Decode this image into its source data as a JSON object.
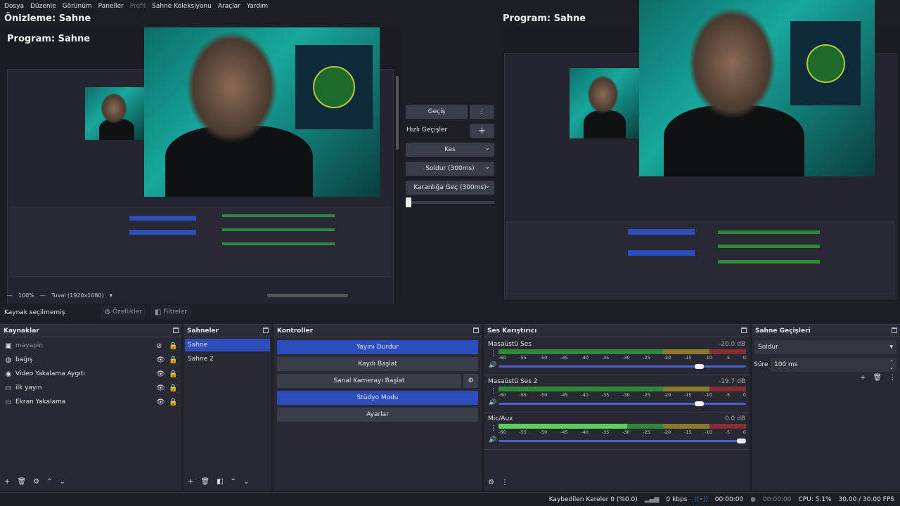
{
  "menu": [
    "Dosya",
    "Düzenle",
    "Görünüm",
    "Paneller",
    "Profil",
    "Sahne Koleksiyonu",
    "Araçlar",
    "Yardım"
  ],
  "menu_disabled": "Profil",
  "preview": {
    "title": "Önizleme: Sahne",
    "inner_program_title": "Program: Sahne",
    "zoom": "100%",
    "canvas": "Tuval (1920x1080)"
  },
  "program": {
    "title": "Program: Sahne"
  },
  "transitions_center": {
    "transition_button": "Geçiş",
    "quick_label": "Hızlı Geçişler",
    "items": [
      "Kes",
      "Soldur (300ms)",
      "Karanlığa Geç (300ms)"
    ]
  },
  "context_bar": {
    "status": "Kaynak seçilmemiş",
    "properties": "Özellikler",
    "filters": "Filtreler"
  },
  "sources": {
    "title": "Kaynaklar",
    "items": [
      {
        "name": "mayapin",
        "icon": "image-icon",
        "visible": false
      },
      {
        "name": "bağış",
        "icon": "browser-icon",
        "visible": true
      },
      {
        "name": "Video Yakalama Aygıtı",
        "icon": "camera-icon",
        "visible": true
      },
      {
        "name": "ilk yayın",
        "icon": "monitor-icon",
        "visible": true
      },
      {
        "name": "Ekran Yakalama",
        "icon": "monitor-icon",
        "visible": true
      }
    ]
  },
  "scenes": {
    "title": "Sahneler",
    "items": [
      "Sahne",
      "Sahne 2"
    ],
    "selected": "Sahne"
  },
  "controls": {
    "title": "Kontroller",
    "stop_stream": "Yayını Durdur",
    "start_record": "Kaydı Başlat",
    "start_virtualcam": "Sanal Kamerayı Başlat",
    "studio_mode": "Stüdyo Modu",
    "settings": "Ayarlar"
  },
  "mixer": {
    "title": "Ses Karıştırıcı",
    "scale": [
      "-60",
      "-55",
      "-50",
      "-45",
      "-40",
      "-35",
      "-30",
      "-25",
      "-20",
      "-15",
      "-10",
      "-5",
      "0"
    ],
    "channels": [
      {
        "name": "Masaüstü Ses",
        "db": "-20.0 dB",
        "volume": 0.83,
        "level": 0,
        "muted_color": true
      },
      {
        "name": "Masaüstü Ses 2",
        "db": "-19.7 dB",
        "volume": 0.83,
        "level": 0,
        "muted_color": true
      },
      {
        "name": "Mic/Aux",
        "db": "0.0 dB",
        "volume": 1.0,
        "level": 0.52,
        "muted_color": false
      }
    ]
  },
  "scene_transitions": {
    "title": "Sahne Geçişleri",
    "selected": "Soldur",
    "duration_label": "Süre",
    "duration_value": "100 ms"
  },
  "status": {
    "dropped": "Kaybedilen Kareler 0 (%0.0)",
    "bitrate": "0 kbps",
    "stream_time": "00:00:00",
    "record_time": "00:00:00",
    "cpu": "CPU: 5.1%",
    "fps": "30.00 / 30.00 FPS"
  },
  "colors": {
    "accent": "#2c4dbb",
    "meter_green": "#2e8a3a",
    "meter_yellow": "#8a7a2c",
    "meter_red": "#8a2c34",
    "meter_active": "#5ad25a"
  }
}
